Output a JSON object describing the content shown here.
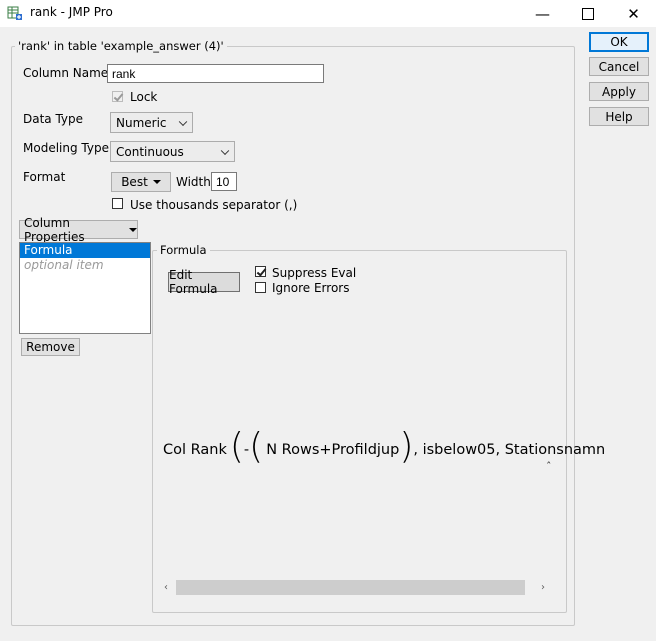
{
  "window": {
    "title": "rank - JMP Pro",
    "minimize_glyph": "—",
    "maximize_glyph": "☐",
    "close_glyph": "✕"
  },
  "dialog_buttons": {
    "ok": "OK",
    "cancel": "Cancel",
    "apply": "Apply",
    "help": "Help"
  },
  "group": {
    "legend": "'rank' in table 'example_answer (4)'"
  },
  "column_name": {
    "label": "Column Name",
    "value": "rank"
  },
  "lock": {
    "label": "Lock",
    "checked": true
  },
  "data_type": {
    "label": "Data Type",
    "value": "Numeric"
  },
  "modeling_type": {
    "label": "Modeling Type",
    "value": "Continuous"
  },
  "format": {
    "label": "Format",
    "value": "Best",
    "width_label": "Width",
    "width_value": "10"
  },
  "thousands": {
    "label": "Use thousands separator (,)",
    "checked": false
  },
  "column_properties": {
    "label": "Column Properties",
    "items": [
      "Formula",
      "optional item"
    ],
    "remove_label": "Remove"
  },
  "formula_panel": {
    "legend": "Formula",
    "edit_label": "Edit Formula",
    "suppress_eval_label": "Suppress Eval",
    "suppress_eval_checked": true,
    "ignore_errors_label": "Ignore Errors",
    "ignore_errors_checked": false,
    "expression": {
      "func": "Col Rank",
      "open_outer": "(",
      "neg": "-",
      "open_inner": "(",
      "term1": "N Rows",
      "op": "+",
      "term2": "Profildjup",
      "close_inner": ")",
      "rest": ", isbelow05, Stationsnamn"
    },
    "caret_glyph": "ˆ"
  },
  "colors": {
    "selection": "#0078d7",
    "dialog_bg": "#f0f0f0"
  }
}
